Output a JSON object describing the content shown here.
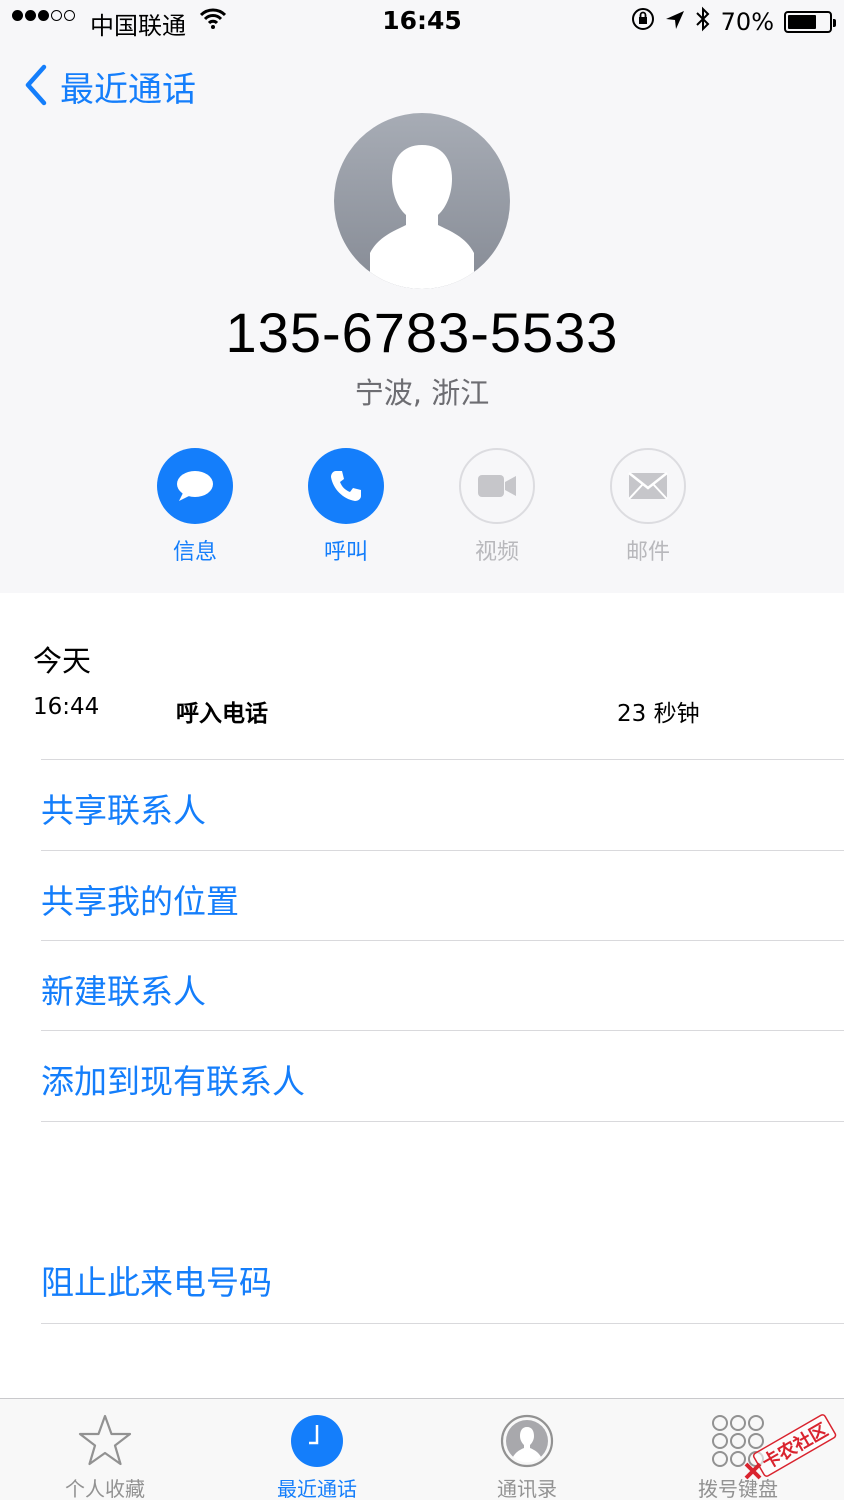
{
  "status_bar": {
    "carrier": "中国联通",
    "time": "16:45",
    "battery": "70%",
    "battery_level": 0.7
  },
  "nav": {
    "back_label": "最近通话"
  },
  "contact": {
    "phone_number": "135-6783-5533",
    "location": "宁波, 浙江"
  },
  "actions": [
    {
      "label": "信息",
      "icon": "message-icon",
      "enabled": true
    },
    {
      "label": "呼叫",
      "icon": "phone-icon",
      "enabled": true
    },
    {
      "label": "视频",
      "icon": "video-icon",
      "enabled": false
    },
    {
      "label": "邮件",
      "icon": "mail-icon",
      "enabled": false
    }
  ],
  "history": {
    "day": "今天",
    "calls": [
      {
        "time": "16:44",
        "type": "呼入电话",
        "duration": "23 秒钟"
      }
    ]
  },
  "options": [
    {
      "label": "共享联系人"
    },
    {
      "label": "共享我的位置"
    },
    {
      "label": "新建联系人"
    },
    {
      "label": "添加到现有联系人"
    }
  ],
  "block_option": {
    "label": "阻止此来电号码"
  },
  "tabs": [
    {
      "label": "个人收藏",
      "icon": "star-icon",
      "active": false
    },
    {
      "label": "最近通话",
      "icon": "clock-icon",
      "active": true
    },
    {
      "label": "通讯录",
      "icon": "contacts-icon",
      "active": false
    },
    {
      "label": "拨号键盘",
      "icon": "keypad-icon",
      "active": false
    }
  ],
  "watermark": {
    "text": "卡农社区"
  },
  "colors": {
    "accent": "#147efb",
    "secondary_text": "#6d6d72",
    "disabled": "#b8b8bc",
    "background_top": "#f7f7f9"
  }
}
